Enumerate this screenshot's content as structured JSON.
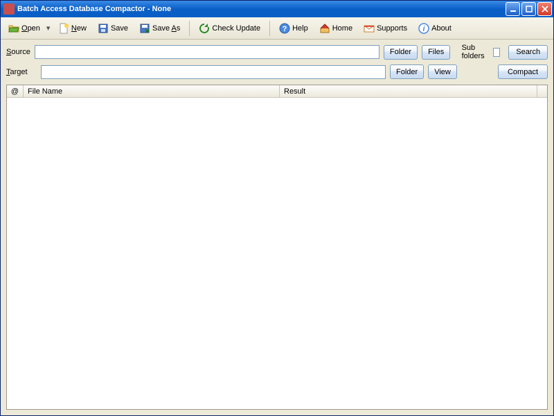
{
  "window": {
    "title": "Batch Access Database Compactor - None"
  },
  "toolbar": {
    "open": "Open",
    "new": "New",
    "save": "Save",
    "save_as": "Save As",
    "check_update": "Check Update",
    "help": "Help",
    "home": "Home",
    "supports": "Supports",
    "about": "About"
  },
  "form": {
    "source_label": "Source",
    "target_label": "Target",
    "source_value": "",
    "target_value": "",
    "folder_btn": "Folder",
    "files_btn": "Files",
    "view_btn": "View",
    "sub_folders_label": "Sub folders",
    "sub_folders_checked": false,
    "search_btn": "Search",
    "compact_btn": "Compact"
  },
  "grid": {
    "col_at": "@",
    "col_filename": "File Name",
    "col_result": "Result",
    "rows": []
  }
}
